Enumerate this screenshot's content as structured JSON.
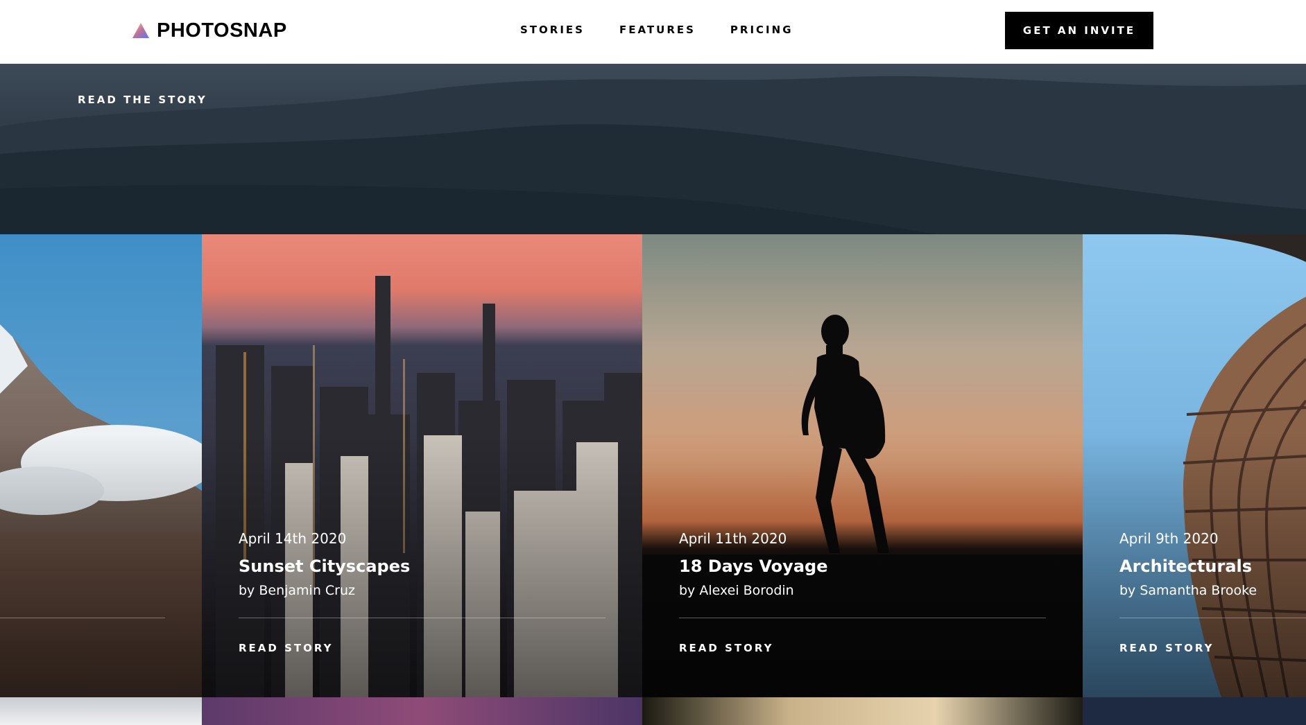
{
  "header": {
    "logo_text": "PHOTOSNAP",
    "nav": [
      "STORIES",
      "FEATURES",
      "PRICING"
    ],
    "cta": "GET AN INVITE"
  },
  "hero": {
    "link": "READ THE STORY"
  },
  "cards": [
    {
      "date": "",
      "title": "",
      "author": "",
      "link": ""
    },
    {
      "date": "April 14th 2020",
      "title": "Sunset Cityscapes",
      "author": "by Benjamin Cruz",
      "link": "READ STORY"
    },
    {
      "date": "April 11th 2020",
      "title": "18 Days Voyage",
      "author": "by Alexei Borodin",
      "link": "READ STORY"
    },
    {
      "date": "April 9th 2020",
      "title": "Architecturals",
      "author": "by Samantha Brooke",
      "link": "READ STORY"
    }
  ],
  "colors": {
    "logo_gradient": [
      "#FFC593",
      "#BC7198",
      "#5A77FF"
    ],
    "header_bg": "#FFFFFF",
    "button_bg": "#000000"
  }
}
